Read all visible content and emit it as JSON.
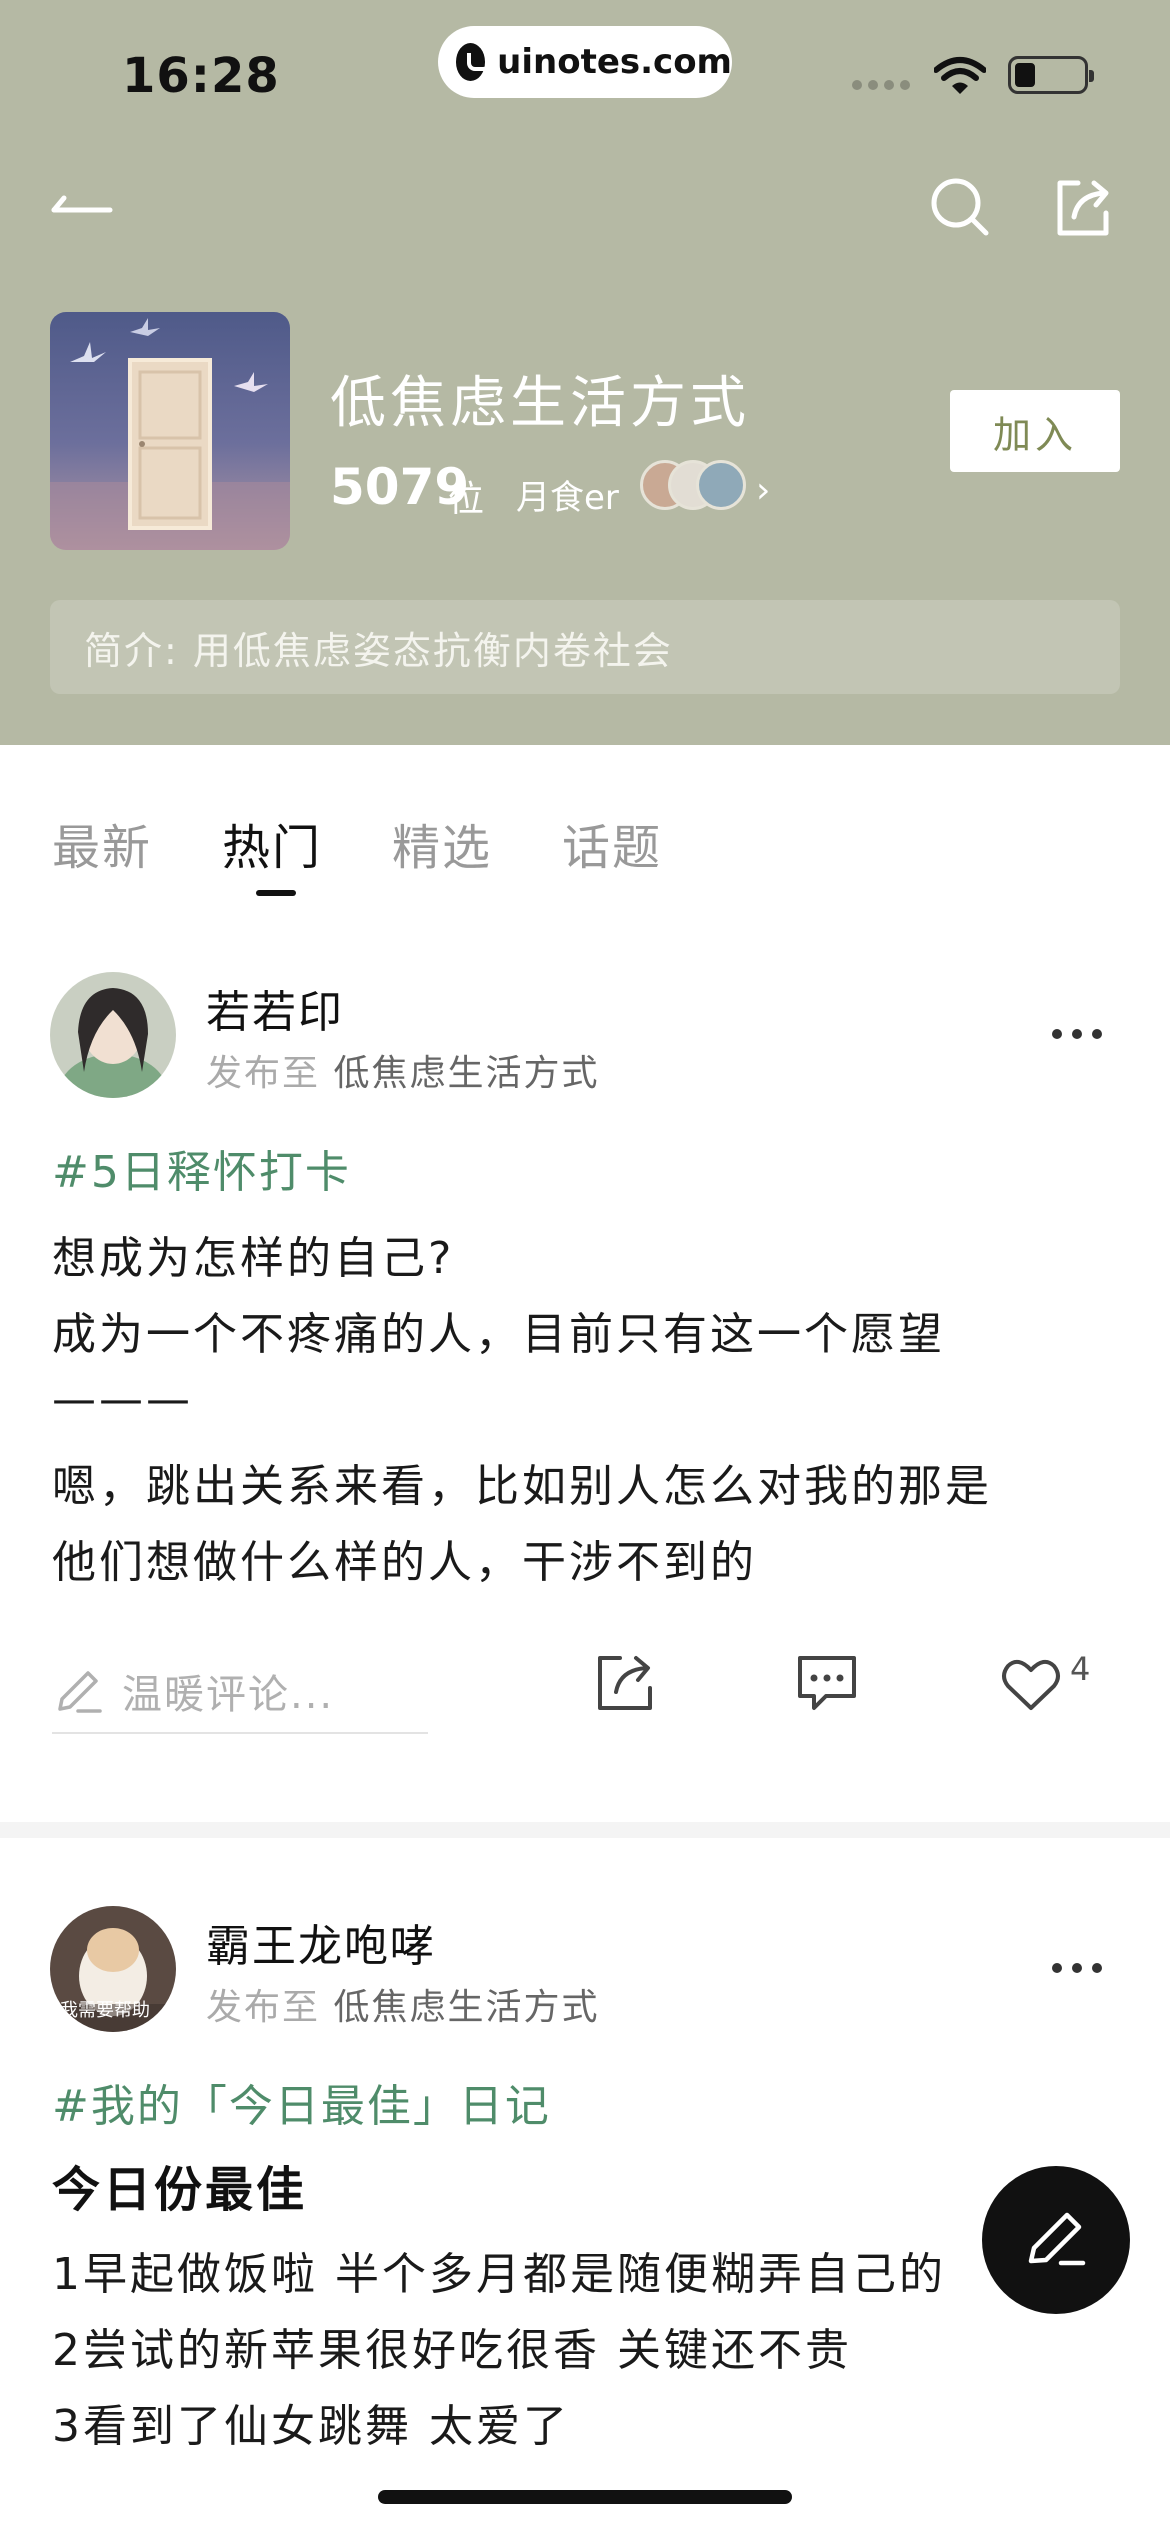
{
  "status_bar": {
    "time": "16:28",
    "url": "uinotes.com"
  },
  "group": {
    "name": "低焦虑生活方式",
    "member_count": "5079",
    "member_unit": "位",
    "member_alias": "月食er",
    "join_label": "加入",
    "intro": "简介: 用低焦虑姿态抗衡内卷社会"
  },
  "tabs": [
    {
      "label": "最新"
    },
    {
      "label": "热门"
    },
    {
      "label": "精选"
    },
    {
      "label": "话题"
    }
  ],
  "active_tab": "热门",
  "posts": [
    {
      "author": "若若印",
      "published_prefix": "发布至",
      "group": "低焦虑生活方式",
      "hashtag": "#5日释怀打卡",
      "lines": [
        "想成为怎样的自己?",
        "成为一个不疼痛的人，目前只有这一个愿望",
        "———",
        "嗯，跳出关系来看，比如别人怎么对我的那是",
        "他们想做什么样的人，干涉不到的"
      ],
      "comment_placeholder": "温暖评论...",
      "like_count": "4"
    },
    {
      "author": "霸王龙咆哮",
      "avatar_caption": "我需要帮助",
      "published_prefix": "发布至",
      "group": "低焦虑生活方式",
      "hashtag": "#我的「今日最佳」日记",
      "title": "今日份最佳",
      "lines": [
        "1早起做饭啦 半个多月都是随便糊弄自己的",
        "2尝试的新苹果很好吃很香 关键还不贵",
        "3看到了仙女跳舞 太爱了"
      ]
    }
  ],
  "colors": {
    "header_bg": "#b5b9a4",
    "accent_green": "#4f8c6a",
    "join_text": "#7f8a55"
  }
}
